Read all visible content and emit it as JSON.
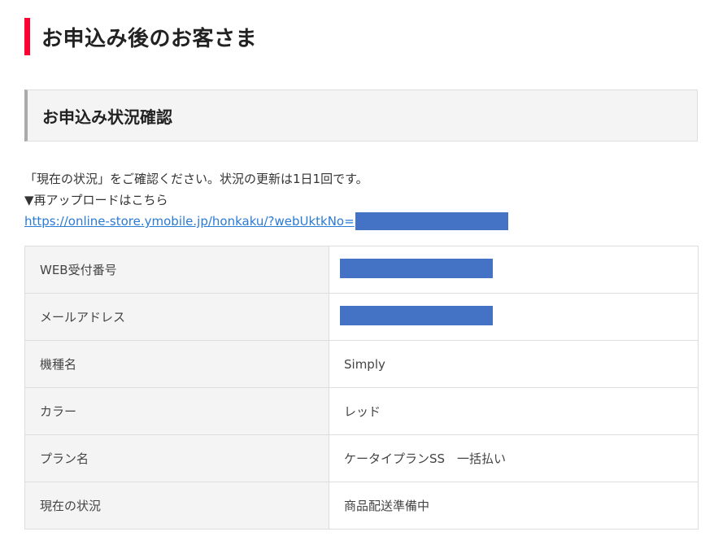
{
  "page": {
    "title": "お申込み後のお客さま",
    "accent_color": "#ff0033"
  },
  "section": {
    "title": "お申込み状況確認"
  },
  "notice": {
    "line1": "「現在の状況」をご確認ください。状況の更新は1日1回です。",
    "line2": "▼再アップロードはこちら",
    "link_text": "https://online-store.ymobile.jp/honkaku/?webUktkNo="
  },
  "redaction_color": "#4472c4",
  "table": {
    "rows": [
      {
        "label": "WEB受付番号",
        "value": "",
        "redacted": true
      },
      {
        "label": "メールアドレス",
        "value": "",
        "redacted": true
      },
      {
        "label": "機種名",
        "value": "Simply",
        "redacted": false
      },
      {
        "label": "カラー",
        "value": "レッド",
        "redacted": false
      },
      {
        "label": "プラン名",
        "value": "ケータイプランSS　一括払い",
        "redacted": false
      },
      {
        "label": "現在の状況",
        "value": "商品配送準備中",
        "redacted": false
      }
    ]
  }
}
